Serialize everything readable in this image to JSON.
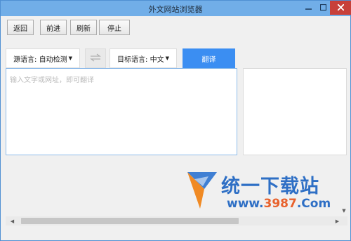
{
  "window": {
    "title": "外文网站浏览器"
  },
  "toolbar": {
    "back_label": "返回",
    "forward_label": "前进",
    "refresh_label": "刷新",
    "stop_label": "停止"
  },
  "translate_bar": {
    "source_lang": "源语言: 自动检测",
    "target_lang": "目标语言: 中文",
    "translate_label": "翻译"
  },
  "source_input": {
    "placeholder": "输入文字或网址，即可翻译",
    "value": ""
  },
  "watermark": {
    "brand": "统一下载站",
    "url_prefix": "www.",
    "url_number": "3987",
    "url_suffix": ".Com"
  },
  "colors": {
    "accent": "#3b8ef2",
    "titlebar": "#71aee8",
    "close": "#c7403a"
  }
}
